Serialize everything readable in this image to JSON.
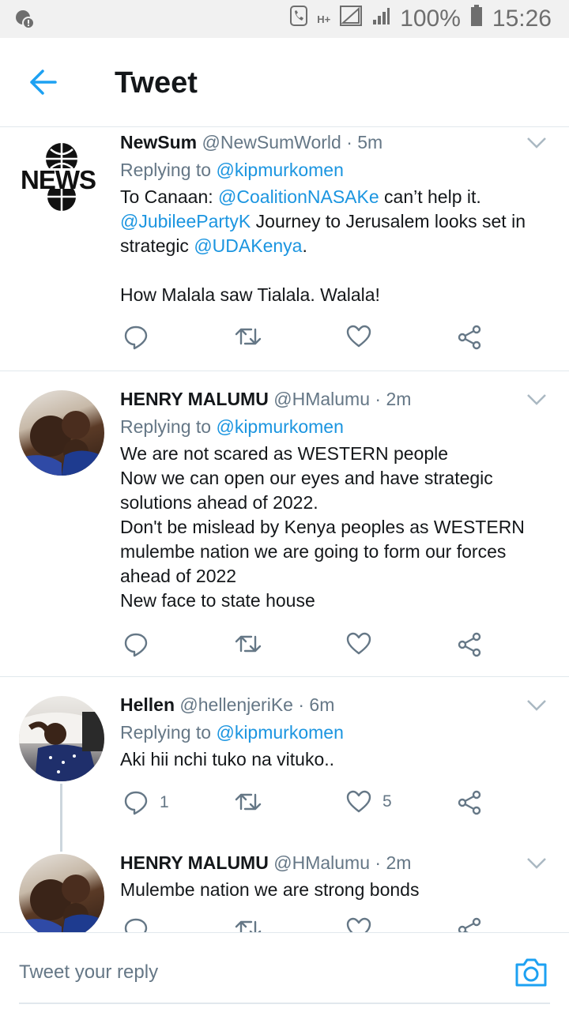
{
  "status_bar": {
    "network": "H+",
    "battery": "100%",
    "time": "15:26"
  },
  "app_bar": {
    "title": "Tweet"
  },
  "tweets": [
    {
      "name": "NewSum",
      "handle": "@NewSumWorld",
      "time": "· 5m",
      "replying_prefix": "Replying to",
      "replying_to": "@kipmurkomen",
      "avatar_text": "NEWS",
      "body_parts": [
        "To Canaan: ",
        "@CoalitionNASAKe",
        " can’t help it. ",
        "@JubileePartyK",
        " Journey to Jerusalem looks set in strategic ",
        "@UDAKenya",
        ".\n\nHow Malala saw Tialala. Walala!"
      ],
      "reply_count": "",
      "like_count": ""
    },
    {
      "name": "HENRY MALUMU",
      "handle": "@HMalumu",
      "time": "· 2m",
      "replying_prefix": "Replying to",
      "replying_to": "@kipmurkomen",
      "body": "We are not scared as WESTERN people\nNow we can open our eyes and have strategic solutions ahead of 2022.\nDon't be mislead by Kenya peoples as WESTERN mulembe nation we are going to form our forces ahead of 2022\nNew face to state house",
      "reply_count": "",
      "like_count": ""
    },
    {
      "name": "Hellen",
      "handle": "@hellenjeriKe",
      "time": "· 6m",
      "replying_prefix": "Replying to",
      "replying_to": "@kipmurkomen",
      "body": "Aki hii nchi tuko na vituko..",
      "reply_count": "1",
      "like_count": "5"
    },
    {
      "name": "HENRY MALUMU",
      "handle": "@HMalumu",
      "time": "· 2m",
      "body": "Mulembe nation we are strong bonds"
    }
  ],
  "composer": {
    "placeholder": "Tweet your reply"
  },
  "colors": {
    "accent": "#1da1f2",
    "link": "#1b95e0",
    "muted": "#657786"
  },
  "icons": [
    "back-arrow-icon",
    "chevron-down-icon",
    "reply-icon",
    "retweet-icon",
    "like-icon",
    "share-icon",
    "camera-icon"
  ]
}
